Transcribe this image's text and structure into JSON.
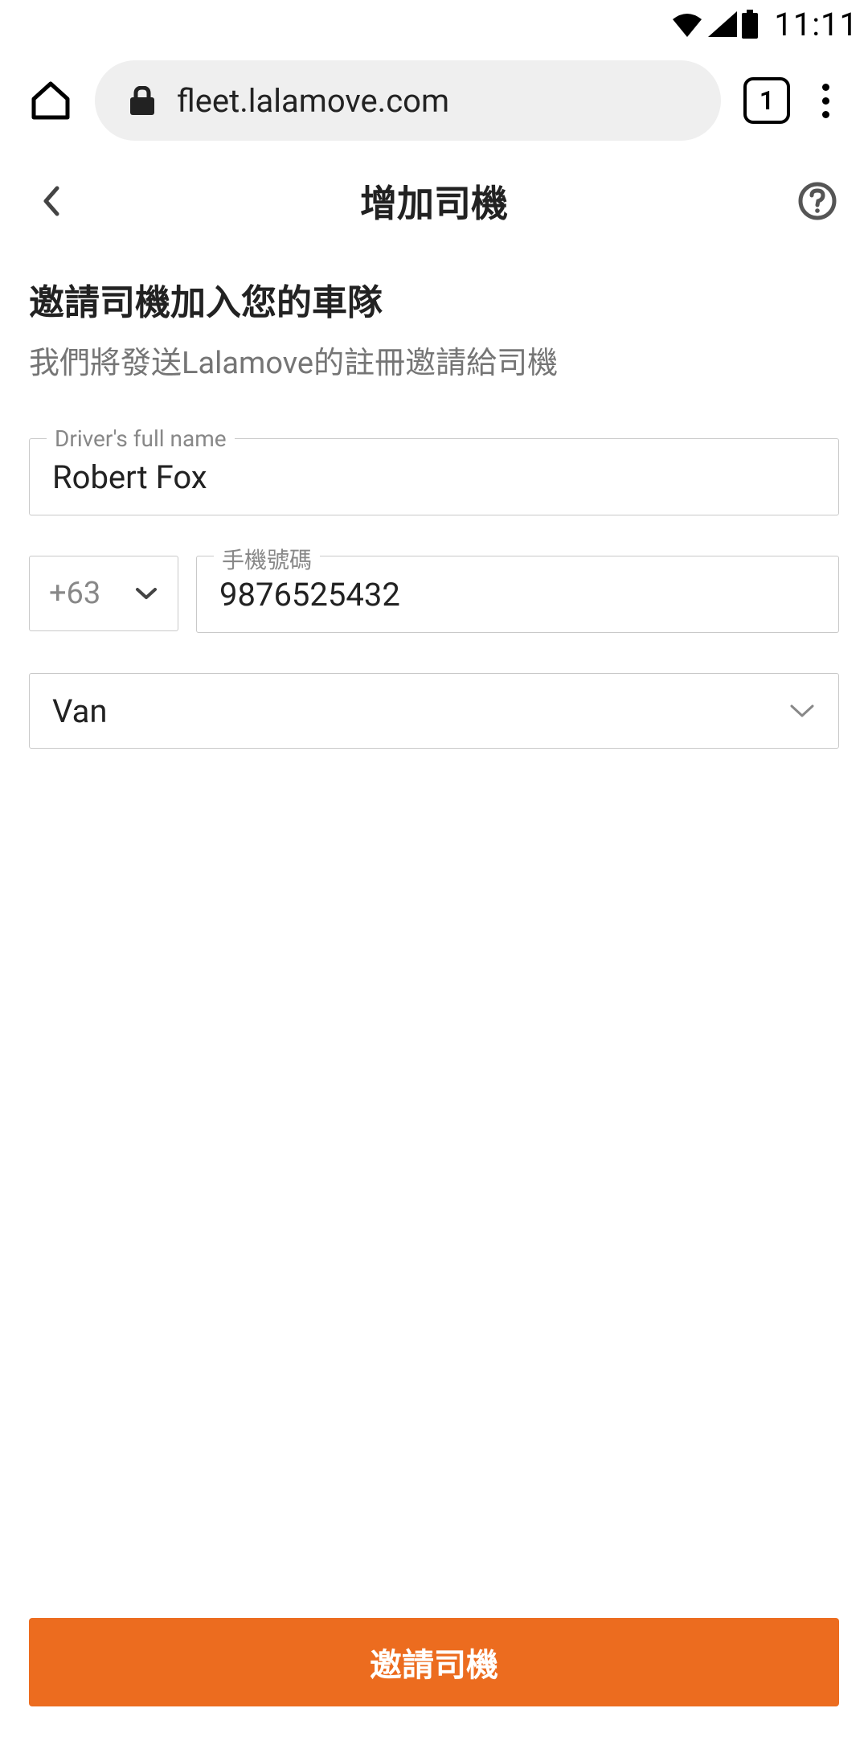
{
  "status_bar": {
    "time": "11:11"
  },
  "browser": {
    "url": "fleet.lalamove.com",
    "tab_count": "1"
  },
  "page": {
    "title": "增加司機",
    "heading": "邀請司機加入您的車隊",
    "subheading": "我們將發送Lalamove的註冊邀請給司機"
  },
  "form": {
    "name_label": "Driver's full name",
    "name_value": "Robert Fox",
    "country_code": "+63",
    "phone_label": "手機號碼",
    "phone_value": "9876525432",
    "vehicle_value": "Van"
  },
  "submit": {
    "label": "邀請司機"
  }
}
